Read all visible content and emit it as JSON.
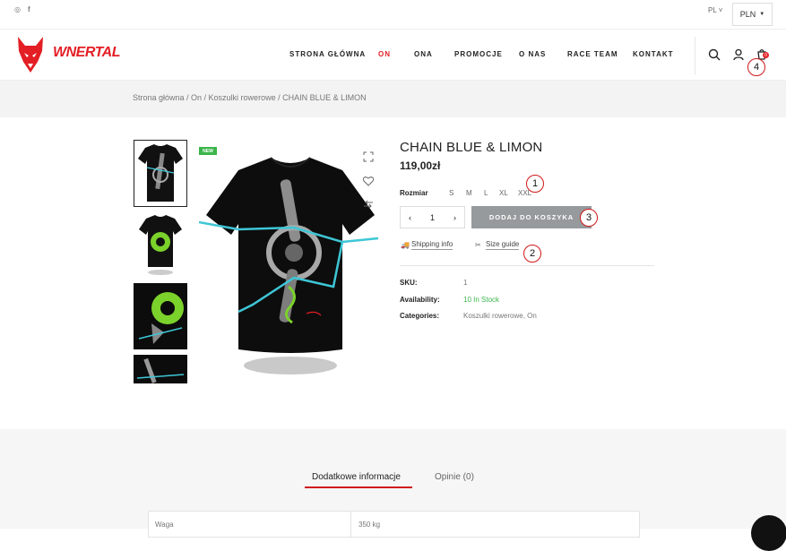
{
  "topbar": {
    "social_icons": [
      "instagram-icon",
      "facebook-icon"
    ],
    "instagram_glyph": "◎",
    "facebook_glyph": "f",
    "language": "PL",
    "currency": "PLN"
  },
  "header": {
    "logo_text": "WNERTAL",
    "nav": [
      "STRONA GŁÓWNA",
      "ON",
      "ONA",
      "PROMOCJE",
      "O NAS",
      "RACE TEAM",
      "KONTAKT"
    ],
    "active_nav": "ON",
    "cart_count": "0",
    "accent_color": "#e31e24"
  },
  "breadcrumb": "Strona główna / On / Koszulki rowerowe / CHAIN BLUE & LIMON",
  "product": {
    "badge": "NEW",
    "title": "CHAIN BLUE & LIMON",
    "price": "119,00zł",
    "size_label": "Rozmiar",
    "sizes": [
      "S",
      "M",
      "L",
      "XL",
      "XXL"
    ],
    "quantity": "1",
    "add_to_cart": "DODAJ DO KOSZYKA",
    "shipping_link": "Shipping info",
    "size_guide_link": "Size guide",
    "meta": {
      "sku_label": "SKU:",
      "sku_value": "1",
      "availability_label": "Availability:",
      "availability_value": "10 In Stock",
      "categories_label": "Categories:",
      "categories_value": "Koszulki rowerowe, On"
    }
  },
  "callouts": [
    "1",
    "2",
    "3",
    "4"
  ],
  "tabs": {
    "items": [
      "Dodatkowe informacje",
      "Opinie (0)"
    ],
    "active": "Dodatkowe informacje",
    "table": {
      "label": "Waga",
      "value": "350 kg"
    }
  }
}
